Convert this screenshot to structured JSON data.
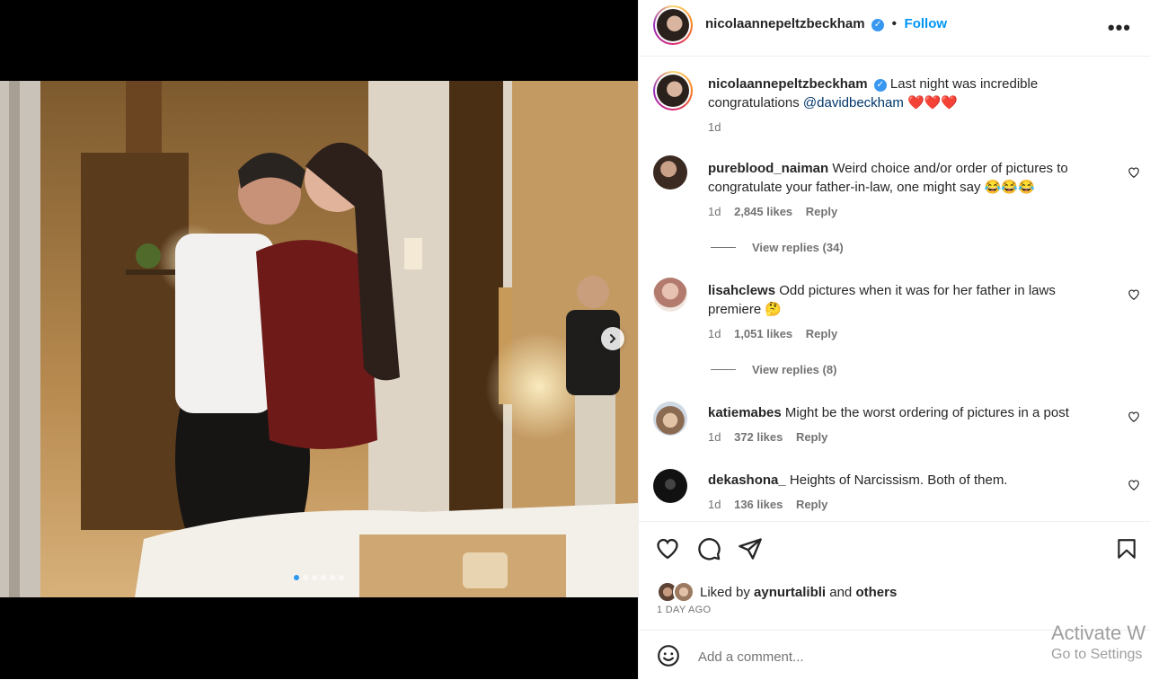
{
  "post": {
    "username": "nicolaannepeltzbeckham",
    "follow_label": "Follow",
    "separator": "•",
    "caption_text": "Last night was incredible congratulations",
    "caption_mention": "@davidbeckham",
    "caption_emoji": "❤️❤️❤️",
    "caption_time": "1d",
    "carousel_count": 6,
    "carousel_active_index": 0
  },
  "comments": [
    {
      "user": "pureblood_naiman",
      "text": "Weird choice and/or order of pictures to congratulate your father-in-law, one might say 😂😂😂",
      "time": "1d",
      "likes": "2,845 likes",
      "reply": "Reply",
      "view_replies": "View replies (34)"
    },
    {
      "user": "lisahclews",
      "text": "Odd pictures when it was for her father in laws premiere 🤔",
      "time": "1d",
      "likes": "1,051 likes",
      "reply": "Reply",
      "view_replies": "View replies (8)"
    },
    {
      "user": "katiemabes",
      "text": "Might be the worst ordering of pictures in a post",
      "time": "1d",
      "likes": "372 likes",
      "reply": "Reply"
    },
    {
      "user": "dekashona_",
      "text": "Heights of Narcissism. Both of them.",
      "time": "1d",
      "likes": "136 likes",
      "reply": "Reply"
    }
  ],
  "engagement": {
    "liked_by_prefix": "Liked by",
    "liked_by_user": "aynurtalibli",
    "liked_by_and": "and",
    "liked_by_others": "others",
    "timestamp": "1 DAY AGO"
  },
  "add_comment": {
    "placeholder": "Add a comment..."
  },
  "watermark": {
    "line1": "Activate W",
    "line2": "Go to Settings"
  },
  "icons": {
    "more": "more-options-icon",
    "like": "heart-icon",
    "comment": "comment-icon",
    "share": "share-icon",
    "save": "bookmark-icon",
    "emoji": "emoji-icon",
    "next": "chevron-right-icon"
  },
  "colors": {
    "accent": "#0095f6",
    "verified": "#3897f0",
    "muted": "#737373",
    "heart_red": "#e0245e"
  }
}
